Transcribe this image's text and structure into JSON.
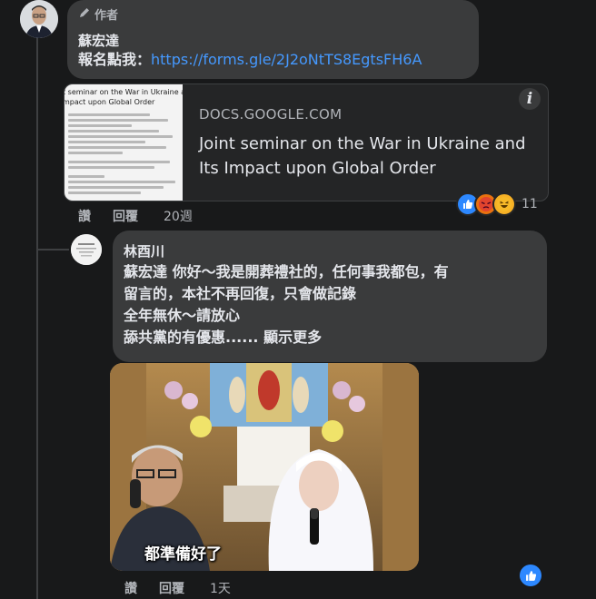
{
  "comment1": {
    "badge": "作者",
    "author": "蘇宏達",
    "text_prefix": "報名點我：",
    "link": "https://forms.gle/2J2oNtTS8EgtsFH6A",
    "card": {
      "domain": "DOCS.GOOGLE.COM",
      "title": "Joint seminar on the War in Ukraine and Its Impact upon Global Order",
      "thumb_text_1": "t seminar on the War in Ukraine and",
      "thumb_text_2": "mpact upon Global Order",
      "info_label": "i"
    },
    "actions": {
      "like": "讚",
      "reply": "回覆",
      "time": "20週"
    },
    "reactions": {
      "icons": [
        "like-icon",
        "angry-icon",
        "haha-icon"
      ],
      "count": "11"
    }
  },
  "comment2": {
    "author": "林酉川",
    "lines": [
      "蘇宏達 你好～我是開葬禮社的，任何事我都包，有",
      "留言的，本社不再回復，只會做記錄",
      "全年無休～請放心",
      "舔共黨的有優惠......"
    ],
    "see_more": "顯示更多",
    "photo_caption": "都準備好了",
    "actions": {
      "like": "讚",
      "reply": "回覆",
      "time": "1天"
    }
  },
  "colors": {
    "background": "#18191a",
    "bubble": "#3a3b3c",
    "link": "#4599ff",
    "like_blue": "#2d88ff"
  }
}
